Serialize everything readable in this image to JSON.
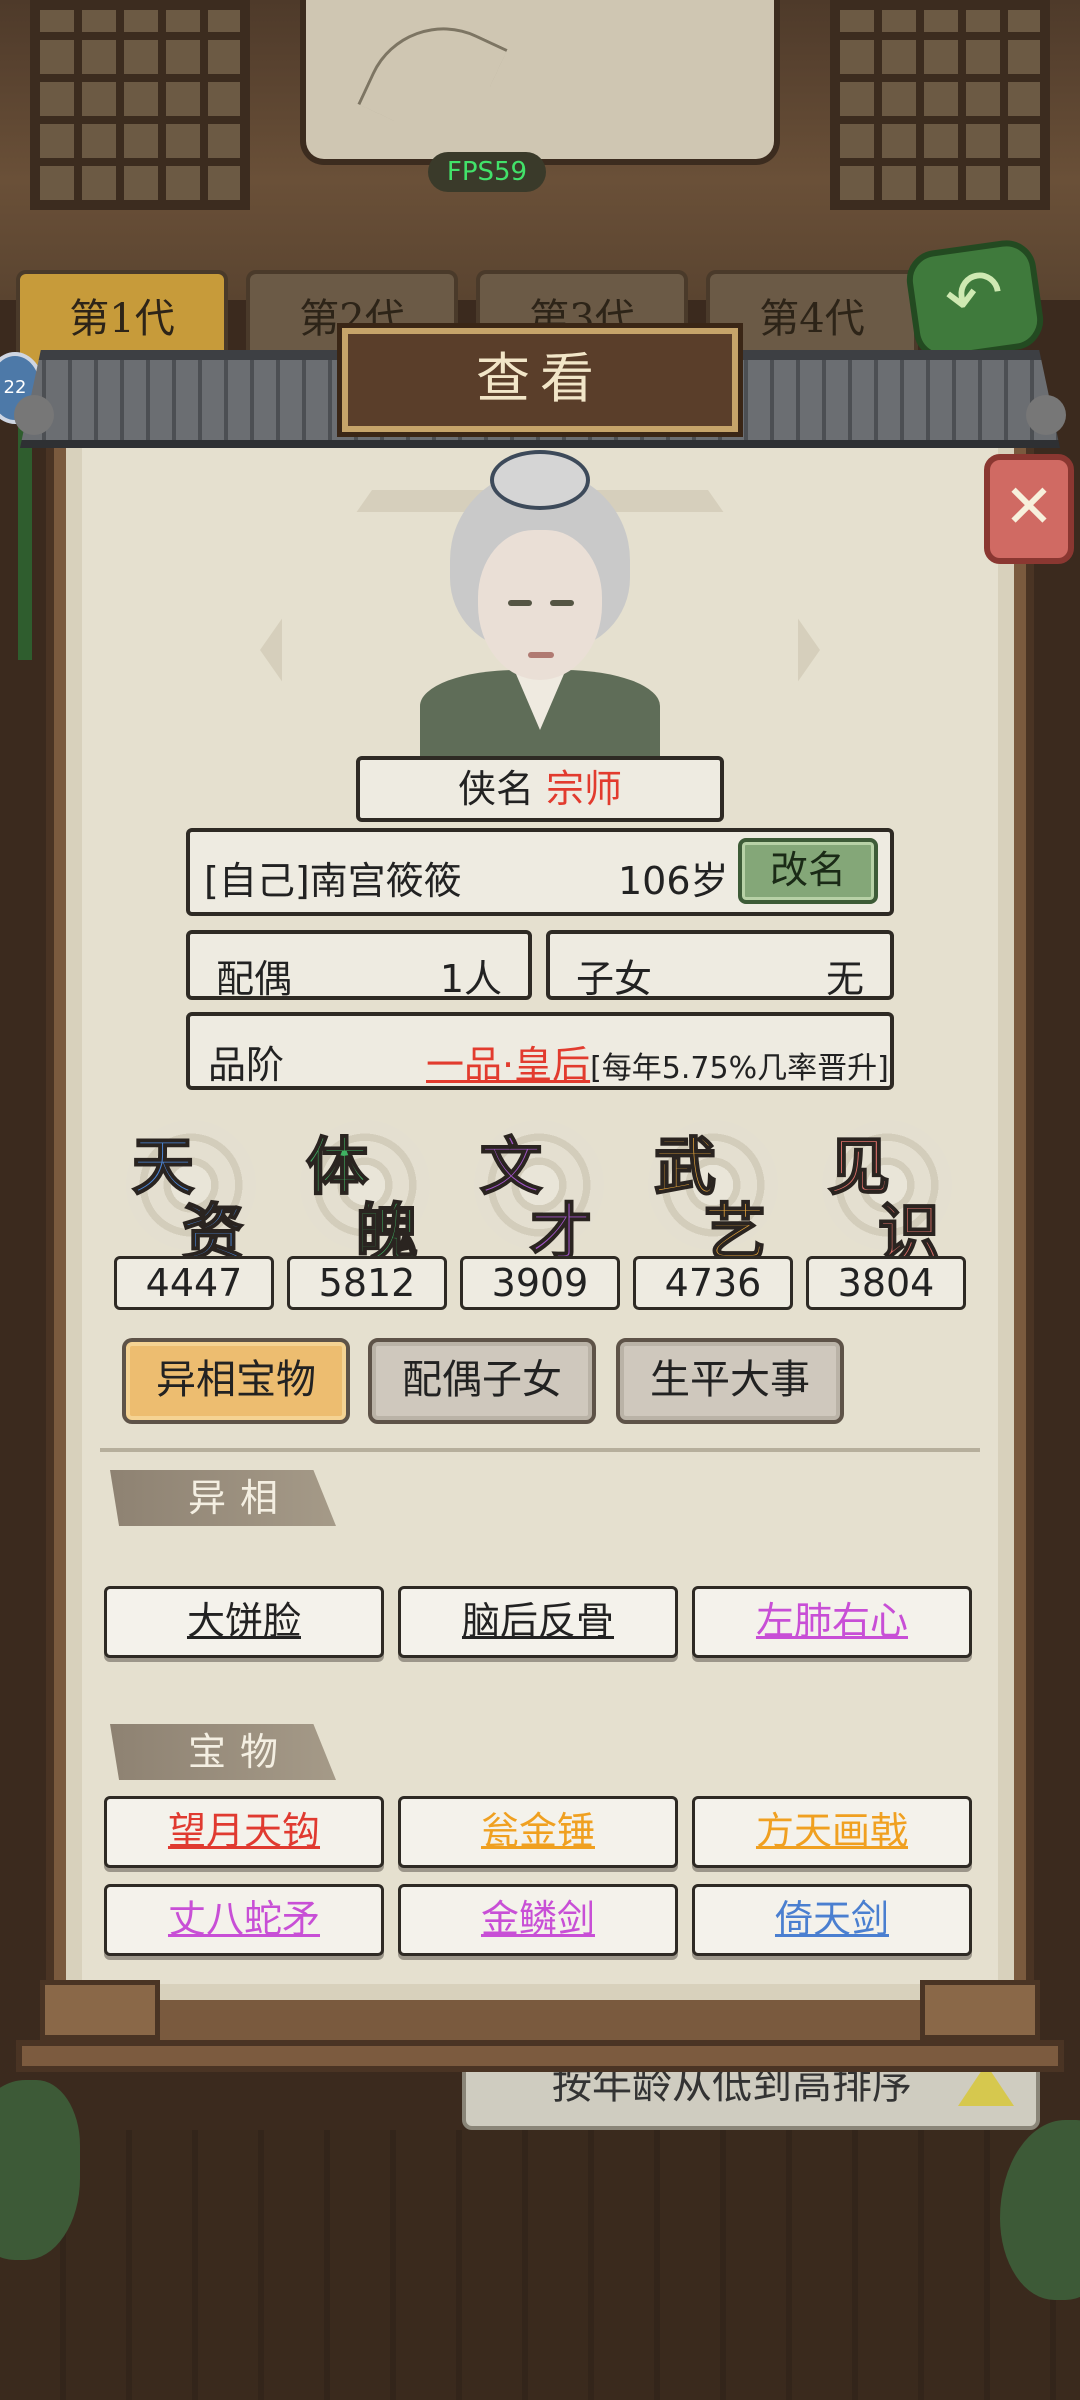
{
  "hud": {
    "fps": "FPS59"
  },
  "generation_tabs": [
    {
      "label": "第1代",
      "active": true
    },
    {
      "label": "第2代",
      "active": false
    },
    {
      "label": "第3代",
      "active": false
    },
    {
      "label": "第4代",
      "active": false
    }
  ],
  "side_badge": "22",
  "modal": {
    "title": "查看",
    "close_glyph": "✕",
    "title_label": "侠名",
    "title_value": "宗师",
    "name": "[自己]南宫筱筱",
    "age": "106岁",
    "rename_label": "改名",
    "spouse_label": "配偶",
    "spouse_value": "1人",
    "children_label": "子女",
    "children_value": "无",
    "rank_label": "品阶",
    "rank_value": "一品·皇后",
    "rank_note": "[每年5.75%几率晋升]",
    "attributes": [
      {
        "c1": "天",
        "c2": "资",
        "value": "4447",
        "color": "#4a86d8"
      },
      {
        "c1": "体",
        "c2": "魄",
        "value": "5812",
        "color": "#3fb262"
      },
      {
        "c1": "文",
        "c2": "才",
        "value": "3909",
        "color": "#a154c8"
      },
      {
        "c1": "武",
        "c2": "艺",
        "value": "4736",
        "color": "#e6a53c"
      },
      {
        "c1": "见",
        "c2": "识",
        "value": "3804",
        "color": "#e0706a"
      }
    ],
    "tabs": [
      {
        "label": "异相宝物",
        "active": true
      },
      {
        "label": "配偶子女",
        "active": false
      },
      {
        "label": "生平大事",
        "active": false
      }
    ],
    "traits_heading": "异相",
    "traits": [
      {
        "label": "大饼脸",
        "color": "#222222"
      },
      {
        "label": "脑后反骨",
        "color": "#222222"
      },
      {
        "label": "左肺右心",
        "color": "#c84fd6"
      }
    ],
    "treasures_heading": "宝物",
    "treasures": [
      {
        "label": "望月天钩",
        "color": "#e03a30"
      },
      {
        "label": "瓮金锤",
        "color": "#f0a020"
      },
      {
        "label": "方天画戟",
        "color": "#f0a020"
      },
      {
        "label": "丈八蛇矛",
        "color": "#c84fd6"
      },
      {
        "label": "金鳞剑",
        "color": "#c84fd6"
      },
      {
        "label": "倚天剑",
        "color": "#4a7fd0"
      }
    ]
  },
  "sort": {
    "label": "按年龄从低到高排序"
  }
}
